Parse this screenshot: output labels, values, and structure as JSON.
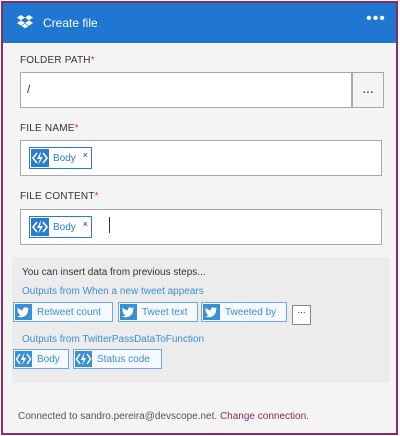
{
  "header": {
    "title": "Create file",
    "more_label": "•••",
    "logo_icon": "dropbox-icon"
  },
  "folder_path": {
    "label": "FOLDER PATH",
    "required_mark": "*",
    "value": "/",
    "browse_label": "..."
  },
  "file_name": {
    "label": "FILE NAME",
    "required_mark": "*",
    "token": {
      "label": "Body",
      "remove": "×",
      "icon": "function-icon"
    }
  },
  "file_content": {
    "label": "FILE CONTENT",
    "required_mark": "*",
    "token": {
      "label": "Body",
      "remove": "×",
      "icon": "function-icon"
    }
  },
  "dynamic_panel": {
    "title": "You can insert data from previous steps...",
    "groups": [
      {
        "heading": "Outputs from When a new tweet appears",
        "items": [
          {
            "label": "Retweet count",
            "icon": "twitter-icon"
          },
          {
            "label": "Tweet text",
            "icon": "twitter-icon"
          },
          {
            "label": "Tweeted by",
            "icon": "twitter-icon"
          }
        ],
        "more_label": "..."
      },
      {
        "heading": "Outputs from TwitterPassDataToFunction",
        "items": [
          {
            "label": "Body",
            "icon": "function-icon"
          },
          {
            "label": "Status code",
            "icon": "function-icon"
          }
        ]
      }
    ]
  },
  "footer": {
    "text": "Connected to sandro.pereira@devscope.net.",
    "link": "Change connection."
  },
  "colors": {
    "header": "#1f77d1",
    "border": "#8a2b63",
    "token": "#2a7ccc",
    "required": "#d33333"
  }
}
